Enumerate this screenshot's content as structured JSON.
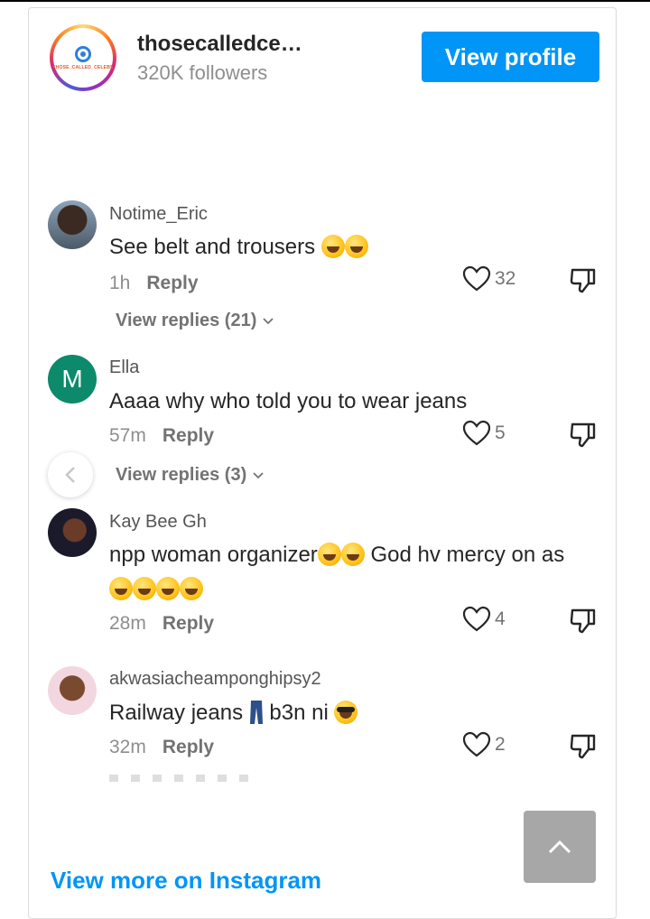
{
  "header": {
    "account_name": "thosecalledce…",
    "followers": "320K followers",
    "view_profile_label": "View profile",
    "logo_text": "THOSE_CALLED_CELEBS"
  },
  "comments": [
    {
      "username": "Notime_Eric",
      "text": "See belt and trousers",
      "emoji_after": [
        "grinning-squinting",
        "grinning-squinting"
      ],
      "time": "1h",
      "reply_label": "Reply",
      "likes": "32",
      "view_replies": "View replies (21)"
    },
    {
      "username": "Ella",
      "avatar_letter": "M",
      "text": "Aaaa why who told you to wear jeans",
      "time": "57m",
      "reply_label": "Reply",
      "likes": "5",
      "view_replies": "View replies (3)"
    },
    {
      "username": "Kay Bee Gh",
      "text_part1": "npp woman organizer",
      "text_part2": " God hv mercy on as",
      "time": "28m",
      "reply_label": "Reply",
      "likes": "4"
    },
    {
      "username": "akwasiacheamponghipsy2",
      "text_part1": "Railway jeans",
      "text_part2": "b3n ni",
      "time": "32m",
      "reply_label": "Reply",
      "likes": "2"
    }
  ],
  "footer": {
    "view_more_label": "View more on Instagram"
  },
  "colors": {
    "accent": "#0095f6",
    "text": "#262626",
    "muted": "#8e8e8e",
    "ella_avatar": "#0c8a6b"
  }
}
